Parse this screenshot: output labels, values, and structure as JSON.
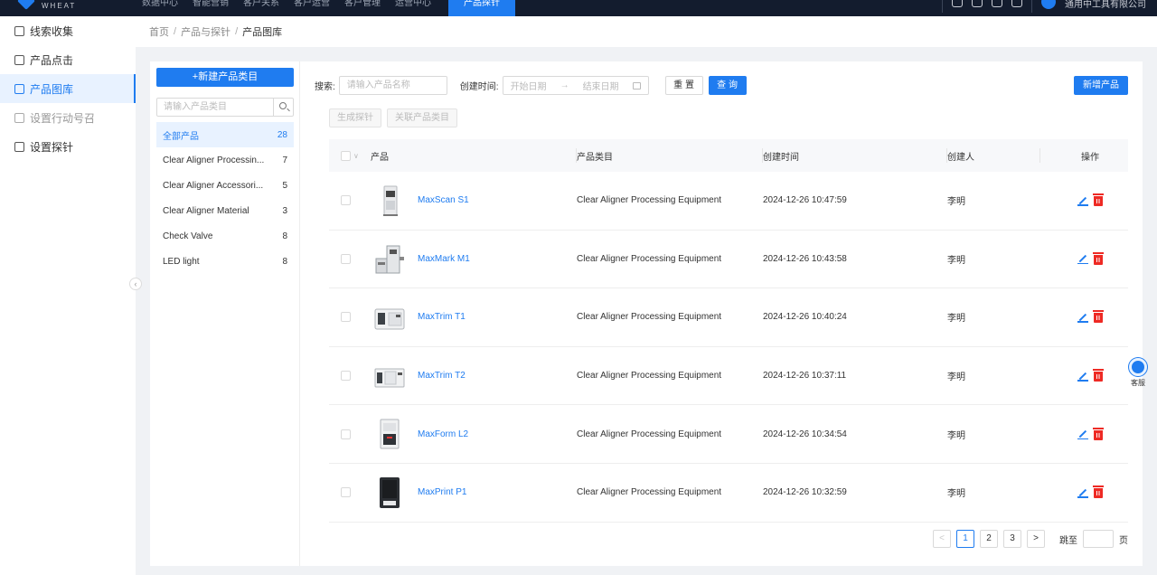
{
  "colors": {
    "primary": "#1f7cf0",
    "danger": "#ee2a24",
    "topbar": "#131c2e"
  },
  "topbar": {
    "logo_text": "WHEAT",
    "nav": [
      "数据中心",
      "智能营销",
      "客户关系",
      "客户运营",
      "客户管理",
      "运营中心",
      "产品探针"
    ],
    "user_label": "通用中工具有限公司"
  },
  "sidebar": {
    "items": [
      {
        "label": "线索收集",
        "icon": "checkbox-icon"
      },
      {
        "label": "产品点击",
        "icon": "qrcode-icon"
      },
      {
        "label": "产品图库",
        "icon": "grid-icon"
      },
      {
        "label": "设置行动号召",
        "icon": "megaphone-icon"
      },
      {
        "label": "设置探针",
        "icon": "list-icon"
      }
    ]
  },
  "breadcrumb": {
    "home": "首页",
    "parent": "产品与探针",
    "current": "产品图库",
    "sep": "/"
  },
  "categories": {
    "new_button": "+新建产品类目",
    "search_placeholder": "请输入产品类目",
    "items": [
      {
        "name": "全部产品",
        "count": "28"
      },
      {
        "name": "Clear Aligner Processin...",
        "count": "7"
      },
      {
        "name": "Clear Aligner Accessori...",
        "count": "5"
      },
      {
        "name": "Clear Aligner Material",
        "count": "3"
      },
      {
        "name": "Check Valve",
        "count": "8"
      },
      {
        "name": "LED light",
        "count": "8"
      }
    ]
  },
  "filter": {
    "search_label": "搜索:",
    "search_placeholder": "请输入产品名称",
    "time_label": "创建时间:",
    "start_placeholder": "开始日期",
    "arrow": "→",
    "end_placeholder": "结束日期",
    "reset": "重 置",
    "query": "查 询",
    "add_product": "新增产品",
    "gen_probe": "生成探针",
    "link_category": "关联产品类目"
  },
  "table": {
    "headers": {
      "product": "产品",
      "category": "产品类目",
      "created": "创建时间",
      "creator": "创建人",
      "actions": "操作"
    },
    "rows": [
      {
        "name": "MaxScan S1",
        "category": "Clear Aligner Processing Equipment",
        "created": "2024-12-26 10:47:59",
        "creator": "李明"
      },
      {
        "name": "MaxMark M1",
        "category": "Clear Aligner Processing Equipment",
        "created": "2024-12-26 10:43:58",
        "creator": "李明"
      },
      {
        "name": "MaxTrim T1",
        "category": "Clear Aligner Processing Equipment",
        "created": "2024-12-26 10:40:24",
        "creator": "李明"
      },
      {
        "name": "MaxTrim T2",
        "category": "Clear Aligner Processing Equipment",
        "created": "2024-12-26 10:37:11",
        "creator": "李明"
      },
      {
        "name": "MaxForm L2",
        "category": "Clear Aligner Processing Equipment",
        "created": "2024-12-26 10:34:54",
        "creator": "李明"
      },
      {
        "name": "MaxPrint P1",
        "category": "Clear Aligner Processing Equipment",
        "created": "2024-12-26 10:32:59",
        "creator": "李明"
      }
    ]
  },
  "pagination": {
    "prev": "<",
    "pages": [
      "1",
      "2",
      "3"
    ],
    "next": ">",
    "jump_label": "跳至",
    "page_suffix": "页"
  },
  "service": {
    "label": "客服"
  }
}
